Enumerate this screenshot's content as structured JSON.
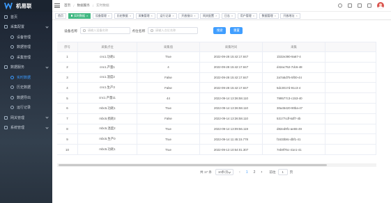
{
  "app": {
    "title": "机易联"
  },
  "sidebar": {
    "items": [
      {
        "label": "首页",
        "level": 1,
        "icon": "home-icon",
        "has_children": false
      },
      {
        "label": "采集配置",
        "level": 1,
        "icon": "settings-icon",
        "has_children": true
      },
      {
        "label": "设备管理",
        "level": 2,
        "icon": "device-icon",
        "has_children": false
      },
      {
        "label": "数据管理",
        "level": 2,
        "icon": "data-icon",
        "has_children": false
      },
      {
        "label": "采集管理",
        "level": 2,
        "icon": "collect-icon",
        "has_children": false
      },
      {
        "label": "数据服务",
        "level": 1,
        "icon": "service-icon",
        "has_children": true
      },
      {
        "label": "实时数据",
        "level": 2,
        "icon": "realtime-icon",
        "has_children": false,
        "active": true
      },
      {
        "label": "历史数据",
        "level": 2,
        "icon": "history-icon",
        "has_children": false
      },
      {
        "label": "数据导出",
        "level": 2,
        "icon": "export-icon",
        "has_children": false
      },
      {
        "label": "运行记录",
        "level": 2,
        "icon": "log-icon",
        "has_children": false
      },
      {
        "label": "网关管理",
        "level": 1,
        "icon": "gateway-icon",
        "has_children": true
      },
      {
        "label": "系统管理",
        "level": 1,
        "icon": "system-icon",
        "has_children": true
      }
    ]
  },
  "header": {
    "breadcrumb": [
      "首页",
      "数据服务",
      "实时数据"
    ]
  },
  "tags": [
    {
      "label": "首页",
      "active": false,
      "closable": false
    },
    {
      "label": "实时数据",
      "active": true,
      "closable": true
    },
    {
      "label": "设备管理",
      "active": false,
      "closable": true
    },
    {
      "label": "历史数据",
      "active": false,
      "closable": true
    },
    {
      "label": "采集管理",
      "active": false,
      "closable": true
    },
    {
      "label": "运行记录",
      "active": false,
      "closable": true
    },
    {
      "label": "开放接口",
      "active": false,
      "closable": true
    },
    {
      "label": "网关配置",
      "active": false,
      "closable": true
    },
    {
      "label": "日志",
      "active": false,
      "closable": true
    },
    {
      "label": "用户管理",
      "active": false,
      "closable": true
    },
    {
      "label": "数据管理",
      "active": false,
      "closable": true
    },
    {
      "label": "开放地址",
      "active": false,
      "closable": true
    }
  ],
  "filters": {
    "device_label": "设备名称",
    "device_placeholder": "请输入设备名称",
    "point_label": "点位名称",
    "point_placeholder": "请输入点位名称",
    "search_label": "搜索",
    "reset_label": "重置"
  },
  "table": {
    "columns": [
      "序号",
      "采集点位",
      "采集值",
      "采集时间",
      "采集"
    ],
    "rows": [
      [
        "1",
        "cnc1.功耗1",
        "True",
        "2022-09-28 15:42:17.847",
        "1b32e390-9a67-4"
      ],
      [
        "2",
        "cnc1.产量1",
        "4",
        "2022-09-28 15:42:17.847",
        "d42ac752-7dc6-48"
      ],
      [
        "3",
        "cnc1.温度2",
        "False",
        "2022-09-28 15:42:17.847",
        "2a7a5d75-5f00-44"
      ],
      [
        "4",
        "cnc1.生产3",
        "False",
        "2022-09-28 15:42:17.847",
        "5dc3017d-91c3-4"
      ],
      [
        "5",
        "cnc1.产量11",
        "44",
        "2022-09-14 13:36:58.110",
        "799577c3-c153-40"
      ],
      [
        "6",
        "mbc5.功耗1",
        "True",
        "2022-09-14 13:36:58.110",
        "30a45420-90ba-47"
      ],
      [
        "7",
        "mbc5.损耗3",
        "False",
        "2022-09-14 13:36:58.110",
        "53177cdf-6df7-4b"
      ],
      [
        "8",
        "mbc5.温度2",
        "True",
        "2022-09-14 13:09:56.119",
        "d82ed9f1-ae65-49"
      ],
      [
        "9",
        "mbc5.生产0",
        "True",
        "2022-09-14 11:45:15.778",
        "f1633b8c-dbf1-41"
      ],
      [
        "10",
        "mbc5.功耗1",
        "True",
        "2022-09-13 10:54:01.307",
        "7eb9f75c-41e1-41"
      ]
    ]
  },
  "pagination": {
    "total": "共 17 条",
    "page_size": "10条/页",
    "prev": "‹",
    "pages": [
      "1",
      "2"
    ],
    "current": "1",
    "next": "›",
    "goto_label": "前往",
    "goto_value": "1",
    "goto_unit": "页"
  },
  "colors": {
    "accent": "#409eff",
    "active_tag": "#42b983",
    "sidebar_bg": "#2b3644"
  }
}
